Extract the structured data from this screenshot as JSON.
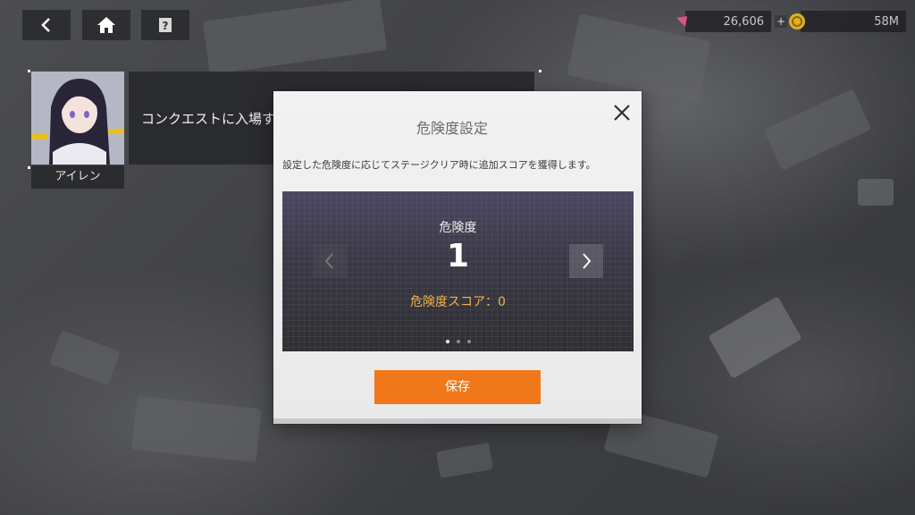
{
  "topbar": {
    "buttons": [
      {
        "name": "back-button",
        "icon": "back-arrow-icon"
      },
      {
        "name": "home-button",
        "icon": "home-icon"
      },
      {
        "name": "help-button",
        "icon": "help-icon"
      }
    ],
    "currency": [
      {
        "icon": "gem-icon",
        "value": "26,606",
        "has_plus": true,
        "color": "#e0508a"
      },
      {
        "icon": "coin-icon",
        "value": "58M",
        "has_plus": false,
        "color": "#e0b020"
      }
    ]
  },
  "tutorial": {
    "character_name": "アイレン",
    "message": "コンクエストに入場する前に、危険度を設定してください。"
  },
  "modal": {
    "title": "危険度設定",
    "description": "設定した危険度に応じてステージクリア時に追加スコアを獲得します。",
    "danger_label": "危険度",
    "danger_value": "1",
    "score_text": "危険度スコア：0",
    "page_dots": 3,
    "active_dot": 0,
    "save_label": "保存"
  },
  "colors": {
    "accent": "#f0781a",
    "score": "#f0b24a"
  }
}
